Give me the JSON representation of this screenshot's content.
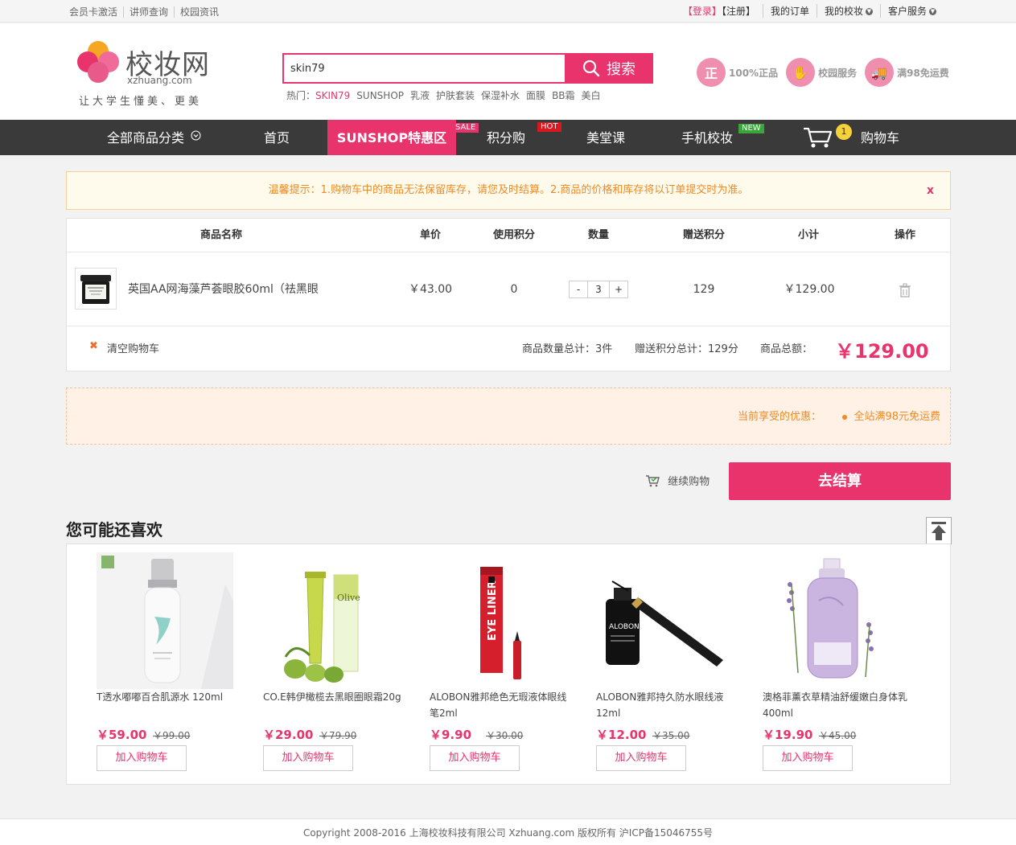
{
  "topbar": {
    "left_links": [
      "会员卡激活",
      "讲师查询",
      "校园资讯"
    ],
    "login": "【登录】",
    "register": "【注册】",
    "my_orders": "我的订单",
    "my_xiaozhuang": "我的校妆",
    "customer_service": "客户服务"
  },
  "logo": {
    "name": "校妆网",
    "domain": "xzhuang.com",
    "slogan": "让大学生懂美、更美"
  },
  "search": {
    "value": "skin79",
    "button": "搜索",
    "hot_label": "热门：",
    "hot_terms": [
      "SKIN79",
      "SUNSHOP",
      "乳液",
      "护肤套装",
      "保湿补水",
      "面膜",
      "BB霜",
      "美白"
    ]
  },
  "badges": [
    {
      "icon": "正",
      "label": "100%正品"
    },
    {
      "icon": "✋",
      "label": "校园服务"
    },
    {
      "icon": "🚚",
      "label": "满98免运费"
    }
  ],
  "nav": {
    "all_categories": "全部商品分类",
    "items": [
      "首页",
      "SUNSHOP特惠区",
      "积分购",
      "美堂课",
      "手机校妆",
      "购物车"
    ],
    "tags": {
      "sale": "SALE",
      "hot": "HOT",
      "new": "NEW"
    },
    "cart_count": "1"
  },
  "notice": {
    "text": "温馨提示：1.购物车中的商品无法保留库存，请您及时结算。2.商品的价格和库存将以订单提交时为准。",
    "close": "x"
  },
  "cart": {
    "headers": [
      "商品名称",
      "单价",
      "使用积分",
      "数量",
      "赠送积分",
      "小计",
      "操作"
    ],
    "item": {
      "name": "英国AA网海藻芦荟眼胶60ml（祛黑眼",
      "unit_price": "￥43.00",
      "points_used": "0",
      "quantity": "3",
      "gift_points": "129",
      "subtotal": "￥129.00",
      "minus": "-",
      "plus": "+"
    },
    "clear": "清空购物车",
    "count_total": "商品数量总计：3件",
    "points_total": "赠送积分总计：129分",
    "amount_label": "商品总额：",
    "amount": "￥129.00"
  },
  "promo": {
    "label": "当前享受的优惠：",
    "value": "全站满98元免运费"
  },
  "actions": {
    "continue": "继续购物",
    "checkout": "去结算"
  },
  "recommend": {
    "title": "您可能还喜欢",
    "add_label": "加入购物车",
    "products": [
      {
        "name": "T透水嘟嘟百合肌源水 120ml",
        "price": "￥59.00",
        "old_price": "￥99.00"
      },
      {
        "name": "CO.E韩伊橄榄去黑眼圈眼霜20g",
        "price": "￥29.00",
        "old_price": "￥79.90"
      },
      {
        "name": "ALOBON雅邦绝色无瑕液体眼线笔2ml",
        "price": "￥9.90",
        "old_price": "￥30.00"
      },
      {
        "name": "ALOBON雅邦持久防水眼线液12ml",
        "price": "￥12.00",
        "old_price": "￥35.00"
      },
      {
        "name": "澳格菲薰衣草精油舒缓嫩白身体乳400ml",
        "price": "￥19.90",
        "old_price": "￥45.00"
      }
    ]
  },
  "footer": {
    "text": "Copyright 2008-2016 上海校妆科技有限公司 Xzhuang.com 版权所有 沪ICP备15046755号"
  },
  "colors": {
    "brand_pink": "#e8336d",
    "nav_dark": "#3a3a3a",
    "notice_orange": "#f08a24"
  }
}
